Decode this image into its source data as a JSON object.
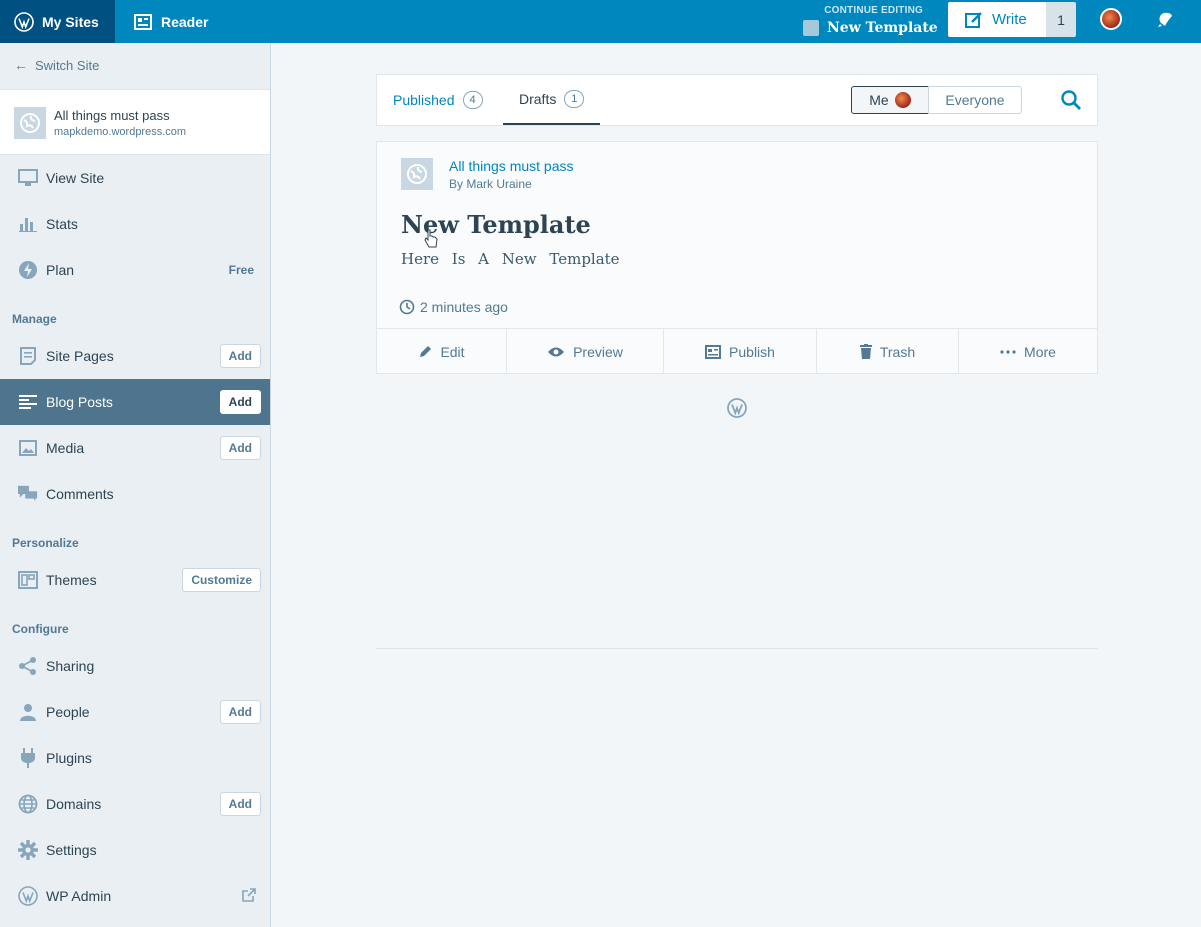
{
  "masterbar": {
    "my_sites": "My Sites",
    "reader": "Reader",
    "continue_caption": "CONTINUE EDITING",
    "continue_title": "New Template",
    "write": "Write",
    "draft_count": "1"
  },
  "sidebar": {
    "switch_site": "Switch Site",
    "site_name": "All things must pass",
    "site_url": "mapkdemo.wordpress.com",
    "items": {
      "view_site": "View Site",
      "stats": "Stats",
      "plan": "Plan",
      "plan_meta": "Free",
      "site_pages": "Site Pages",
      "blog_posts": "Blog Posts",
      "media": "Media",
      "comments": "Comments",
      "themes": "Themes",
      "sharing": "Sharing",
      "people": "People",
      "plugins": "Plugins",
      "domains": "Domains",
      "settings": "Settings",
      "wp_admin": "WP Admin"
    },
    "sections": {
      "manage": "Manage",
      "personalize": "Personalize",
      "configure": "Configure"
    },
    "add_label": "Add",
    "customize_label": "Customize"
  },
  "tabs": {
    "published": "Published",
    "published_count": "4",
    "drafts": "Drafts",
    "drafts_count": "1",
    "me": "Me",
    "everyone": "Everyone"
  },
  "post": {
    "site": "All things must pass",
    "author": "By Mark Uraine",
    "title": "New Template",
    "excerpt": "Here Is A New Template",
    "time": "2 minutes ago",
    "actions": {
      "edit": "Edit",
      "preview": "Preview",
      "publish": "Publish",
      "trash": "Trash",
      "more": "More"
    }
  },
  "colors": {
    "masterbar": "#0087be",
    "masterbar_dark": "#005082",
    "sidebar_bg": "#e9eff3",
    "active_item": "#4f748e",
    "link": "#0087be",
    "text": "#2e4453"
  }
}
